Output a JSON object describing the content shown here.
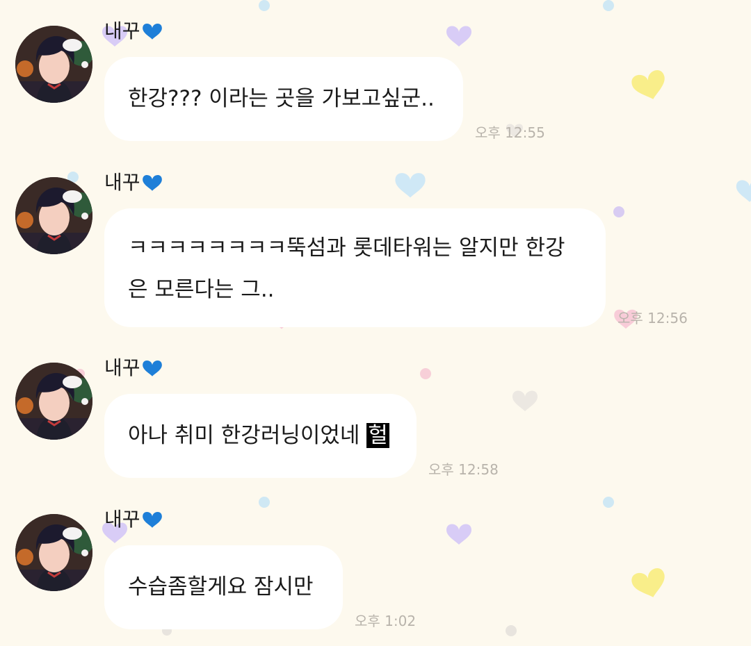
{
  "background_color": "#fdf9ee",
  "bubble_color": "#ffffff",
  "messages": [
    {
      "sender": "내꾸",
      "sender_icon": "blue-heart-emoji",
      "lines": [
        "한강??? 이라는 곳을 가보고싶군.."
      ],
      "time": "오후 12:55"
    },
    {
      "sender": "내꾸",
      "sender_icon": "blue-heart-emoji",
      "lines": [
        "ㅋㅋㅋㅋㅋㅋㅋㅋ뚝섬과 롯데타워는 알지만 한강",
        "은 모른다는 그.."
      ],
      "time": "오후 12:56"
    },
    {
      "sender": "내꾸",
      "sender_icon": "blue-heart-emoji",
      "text_before_highlight": "아나 취미 한강러닝이었네 ",
      "highlighted_text": "헐",
      "time": "오후 12:58"
    },
    {
      "sender": "내꾸",
      "sender_icon": "blue-heart-emoji",
      "lines": [
        "수습좀할게요 잠시만"
      ],
      "time": "오후 1:02"
    }
  ]
}
